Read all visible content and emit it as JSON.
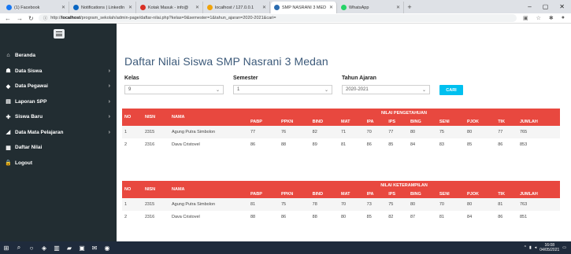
{
  "browser": {
    "tabs": [
      {
        "label": "(1) Facebook",
        "color": "#1877f2"
      },
      {
        "label": "Notifications | LinkedIn",
        "color": "#0a66c2"
      },
      {
        "label": "Kotak Masuk - info@",
        "color": "#d93025"
      },
      {
        "label": "localhost / 127.0.0.1",
        "color": "#f0a30a"
      },
      {
        "label": "SMP NASRANI 3 MED",
        "color": "#2b6cb0",
        "active": true
      },
      {
        "label": "WhatsApp",
        "color": "#25d366"
      }
    ],
    "url_prefix": "http://",
    "url_host": "localhost",
    "url_path": "/program_sekolah/admin-page/daftar-nilai.php?kelas=9&semester=1&tahun_ajaran=2020-2021&cari="
  },
  "sidebar": {
    "items": [
      {
        "label": "Beranda",
        "icon": "home-icon",
        "glyph": "⌂",
        "arrow": false
      },
      {
        "label": "Data Siswa",
        "icon": "users-icon",
        "glyph": "☗",
        "arrow": true
      },
      {
        "label": "Data Pegawai",
        "icon": "tag-icon",
        "glyph": "◆",
        "arrow": true
      },
      {
        "label": "Laporan SPP",
        "icon": "list-icon",
        "glyph": "▤",
        "arrow": true
      },
      {
        "label": "Siswa Baru",
        "icon": "user-plus-icon",
        "glyph": "✚",
        "arrow": true
      },
      {
        "label": "Data Mata Pelajaran",
        "icon": "book-icon",
        "glyph": "◢",
        "arrow": true
      },
      {
        "label": "Daftar Nilai",
        "icon": "table-icon",
        "glyph": "▦",
        "arrow": false
      },
      {
        "label": "Logout",
        "icon": "lock-icon",
        "glyph": "🔒",
        "arrow": false
      }
    ]
  },
  "page": {
    "title": "Daftar Nilai Siswa SMP Nasrani 3 Medan",
    "kelas_label": "Kelas",
    "kelas_value": "9",
    "semester_label": "Semester",
    "semester_value": "1",
    "tahun_label": "Tahun Ajaran",
    "tahun_value": "2020-2021",
    "cari_label": "CARI"
  },
  "table_pengetahuan": {
    "group_label": "NILAI PENGETAHUAN",
    "headers": [
      "NO",
      "NISN",
      "NAMA"
    ],
    "subjects": [
      "PABP",
      "PPKN",
      "BIND",
      "MAT",
      "IPA",
      "IPS",
      "BING",
      "SENI",
      "PJOK",
      "TIK",
      "JUMLAH"
    ],
    "rows": [
      [
        "1",
        "2315",
        "Agung Putra Simbolon",
        "77",
        "76",
        "82",
        "71",
        "70",
        "77",
        "80",
        "75",
        "80",
        "77",
        "765"
      ],
      [
        "2",
        "2316",
        "Dava Cristovel",
        "86",
        "88",
        "89",
        "81",
        "86",
        "85",
        "84",
        "83",
        "85",
        "86",
        "853"
      ]
    ]
  },
  "table_keterampilan": {
    "group_label": "NILAI KETERAMPILAN",
    "headers": [
      "NO",
      "NISN",
      "NAMA"
    ],
    "subjects": [
      "PABP",
      "PPKN",
      "BIND",
      "MAT",
      "IPA",
      "IPS",
      "BING",
      "SENI",
      "PJOK",
      "TIK",
      "JUMLAH"
    ],
    "rows": [
      [
        "1",
        "2315",
        "Agung Putra Simbolon",
        "81",
        "75",
        "78",
        "70",
        "73",
        "75",
        "80",
        "70",
        "80",
        "81",
        "763"
      ],
      [
        "2",
        "2316",
        "Dava Cristovel",
        "88",
        "86",
        "88",
        "80",
        "85",
        "82",
        "87",
        "81",
        "84",
        "86",
        "851"
      ]
    ]
  },
  "taskbar": {
    "time": "16:08",
    "date": "04/05/2021"
  }
}
